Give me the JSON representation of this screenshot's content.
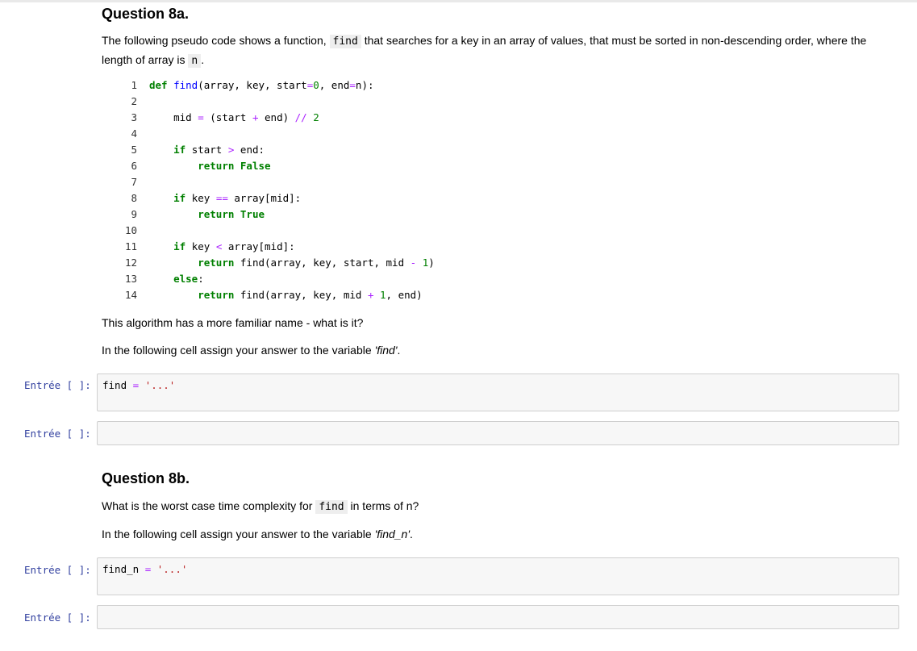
{
  "q8a": {
    "title": "Question 8a.",
    "intro_1": "The following pseudo code shows a function, ",
    "intro_code_find": "find",
    "intro_2": " that searches for a key in an array of values, that must be sorted in non-descending order, where the length of array is ",
    "intro_code_n": "n",
    "intro_3": ".",
    "question": "This algorithm has a more familiar name - what is it?",
    "instruction_1": "In the following cell assign your answer to the variable ",
    "instruction_var": "'find'",
    "instruction_2": "."
  },
  "code_lines": [
    {
      "n": "1",
      "text": "def find(array, key, start=0, end=n):"
    },
    {
      "n": "2",
      "text": ""
    },
    {
      "n": "3",
      "text": "    mid = (start + end) // 2"
    },
    {
      "n": "4",
      "text": ""
    },
    {
      "n": "5",
      "text": "    if start > end:"
    },
    {
      "n": "6",
      "text": "        return False"
    },
    {
      "n": "7",
      "text": ""
    },
    {
      "n": "8",
      "text": "    if key == array[mid]:"
    },
    {
      "n": "9",
      "text": "        return True"
    },
    {
      "n": "10",
      "text": ""
    },
    {
      "n": "11",
      "text": "    if key < array[mid]:"
    },
    {
      "n": "12",
      "text": "        return find(array, key, start, mid - 1)"
    },
    {
      "n": "13",
      "text": "    else:"
    },
    {
      "n": "14",
      "text": "        return find(array, key, mid + 1, end)"
    }
  ],
  "cells": {
    "prompt": "Entrée [ ]:",
    "cell1_var": "find",
    "cell1_eq": "=",
    "cell1_val": "'...'",
    "cell3_var": "find_n",
    "cell3_eq": "=",
    "cell3_val": "'...'"
  },
  "q8b": {
    "title": "Question 8b.",
    "q_1": "What is the worst case time complexity for ",
    "q_code": "find",
    "q_2": " in terms of n?",
    "instruction_1": "In the following cell assign your answer to the variable ",
    "instruction_var": "'find_n'",
    "instruction_2": "."
  },
  "colors": {
    "keyword": "#008000",
    "function_name": "#0000ff",
    "operator": "#aa22ff",
    "string": "#ba2121",
    "prompt": "#303f9f"
  }
}
